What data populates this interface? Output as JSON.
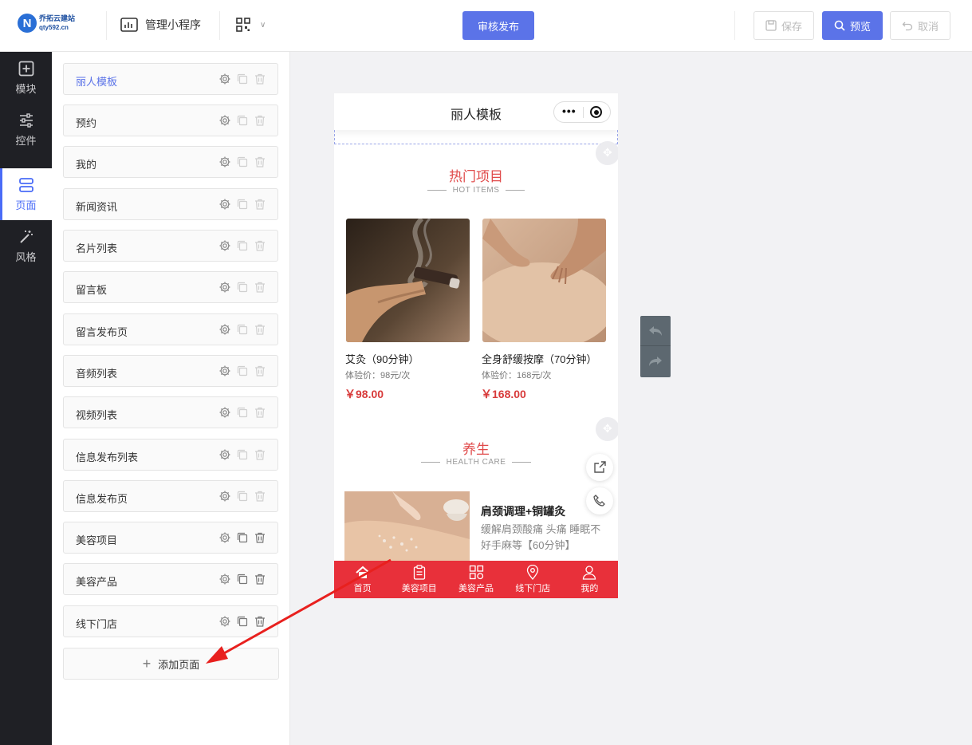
{
  "header": {
    "logo_name": "乔拓云建站",
    "logo_url": "qty592.cn",
    "manage_label": "管理小程序",
    "review_publish": "审核发布",
    "save": "保存",
    "preview": "预览",
    "cancel": "取消"
  },
  "sidebar": {
    "items": [
      {
        "label": "模块",
        "icon": "plus-square-icon"
      },
      {
        "label": "控件",
        "icon": "sliders-icon"
      },
      {
        "label": "页面",
        "icon": "pages-icon",
        "active": true
      },
      {
        "label": "风格",
        "icon": "magic-wand-icon"
      }
    ]
  },
  "pages": {
    "items": [
      {
        "label": "丽人模板",
        "active": true
      },
      {
        "label": "预约"
      },
      {
        "label": "我的"
      },
      {
        "label": "新闻资讯"
      },
      {
        "label": "名片列表"
      },
      {
        "label": "留言板"
      },
      {
        "label": "留言发布页"
      },
      {
        "label": "音频列表"
      },
      {
        "label": "视频列表"
      },
      {
        "label": "信息发布列表"
      },
      {
        "label": "信息发布页"
      },
      {
        "label": "美容项目"
      },
      {
        "label": "美容产品"
      },
      {
        "label": "线下门店"
      }
    ],
    "add_page": "添加页面"
  },
  "phone": {
    "title": "丽人模板",
    "hot": {
      "title": "热门项目",
      "subtitle": "HOT ITEMS",
      "items": [
        {
          "name": "艾灸（90分钟）",
          "note": "体验价：98元/次",
          "price": "￥98.00"
        },
        {
          "name": "全身舒缓按摩（70分钟）",
          "note": "体验价：168元/次",
          "price": "￥168.00"
        }
      ]
    },
    "health": {
      "title": "养生",
      "subtitle": "HEALTH CARE",
      "item_title": "肩颈调理+铜罐灸",
      "item_desc": "缓解肩颈酸痛 头痛 睡眠不好手麻等【60分钟】"
    },
    "tabs": [
      {
        "label": "首页",
        "icon": "home-icon"
      },
      {
        "label": "美容项目",
        "icon": "clipboard-icon"
      },
      {
        "label": "美容产品",
        "icon": "grid-icon"
      },
      {
        "label": "线下门店",
        "icon": "location-pin-icon"
      },
      {
        "label": "我的",
        "icon": "user-icon"
      }
    ]
  },
  "colors": {
    "accent": "#5b73e8",
    "tabbar": "#e8303a",
    "section_title": "#e04a4a",
    "price": "#d83b3b",
    "sidebar_bg": "#1f2025"
  }
}
